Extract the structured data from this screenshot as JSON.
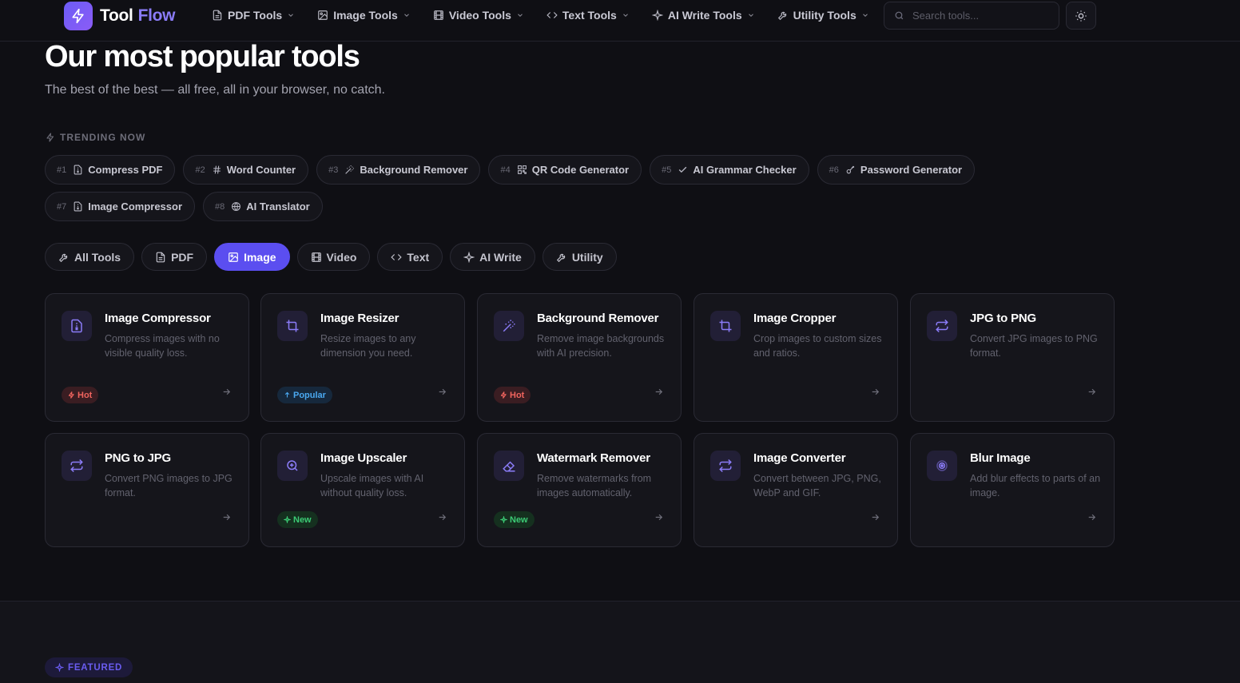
{
  "brand": {
    "name_a": "Tool",
    "name_b": "Flow",
    "accent": "#8b7cf8"
  },
  "nav": {
    "items": [
      {
        "label": "PDF Tools",
        "icon": "file-icon"
      },
      {
        "label": "Image Tools",
        "icon": "image-icon"
      },
      {
        "label": "Video Tools",
        "icon": "film-icon"
      },
      {
        "label": "Text Tools",
        "icon": "code-icon"
      },
      {
        "label": "AI Write Tools",
        "icon": "sparkle-icon"
      },
      {
        "label": "Utility Tools",
        "icon": "wrench-icon"
      }
    ]
  },
  "search": {
    "placeholder": "Search tools..."
  },
  "hero": {
    "title": "Our most popular tools",
    "subtitle": "The best of the best — all free, all in your browser, no catch."
  },
  "trending": {
    "label": "TRENDING NOW",
    "items": [
      {
        "rank": "#1",
        "label": "Compress PDF",
        "icon": "file-zip-icon"
      },
      {
        "rank": "#2",
        "label": "Word Counter",
        "icon": "hash-icon"
      },
      {
        "rank": "#3",
        "label": "Background Remover",
        "icon": "wand-icon"
      },
      {
        "rank": "#4",
        "label": "QR Code Generator",
        "icon": "qr-icon"
      },
      {
        "rank": "#5",
        "label": "AI Grammar Checker",
        "icon": "check-icon"
      },
      {
        "rank": "#6",
        "label": "Password Generator",
        "icon": "key-icon"
      },
      {
        "rank": "#7",
        "label": "Image Compressor",
        "icon": "file-zip-icon"
      },
      {
        "rank": "#8",
        "label": "AI Translator",
        "icon": "globe-icon"
      }
    ]
  },
  "tabs": [
    {
      "label": "All Tools",
      "icon": "wrench-icon",
      "active": false
    },
    {
      "label": "PDF",
      "icon": "file-icon",
      "active": false
    },
    {
      "label": "Image",
      "icon": "image-icon",
      "active": true
    },
    {
      "label": "Video",
      "icon": "film-icon",
      "active": false
    },
    {
      "label": "Text",
      "icon": "code-icon",
      "active": false
    },
    {
      "label": "AI Write",
      "icon": "sparkle-icon",
      "active": false
    },
    {
      "label": "Utility",
      "icon": "wrench-icon",
      "active": false
    }
  ],
  "cards": [
    {
      "title": "Image Compressor",
      "desc": "Compress images with no visible quality loss.",
      "badge": "Hot",
      "icon": "file-zip-icon"
    },
    {
      "title": "Image Resizer",
      "desc": "Resize images to any dimension you need.",
      "badge": "Popular",
      "icon": "crop-icon"
    },
    {
      "title": "Background Remover",
      "desc": "Remove image backgrounds with AI precision.",
      "badge": "Hot",
      "icon": "wand-icon"
    },
    {
      "title": "Image Cropper",
      "desc": "Crop images to custom sizes and ratios.",
      "badge": "",
      "icon": "crop-icon"
    },
    {
      "title": "JPG to PNG",
      "desc": "Convert JPG images to PNG format.",
      "badge": "",
      "icon": "convert-icon"
    },
    {
      "title": "PNG to JPG",
      "desc": "Convert PNG images to JPG format.",
      "badge": "",
      "icon": "convert-icon"
    },
    {
      "title": "Image Upscaler",
      "desc": "Upscale images with AI without quality loss.",
      "badge": "New",
      "icon": "zoom-in-icon"
    },
    {
      "title": "Watermark Remover",
      "desc": "Remove watermarks from images automatically.",
      "badge": "New",
      "icon": "eraser-icon"
    },
    {
      "title": "Image Converter",
      "desc": "Convert between JPG, PNG, WebP and GIF.",
      "badge": "",
      "icon": "convert-icon"
    },
    {
      "title": "Blur Image",
      "desc": "Add blur effects to parts of an image.",
      "badge": "",
      "icon": "target-icon"
    }
  ],
  "featured": {
    "label": "FEATURED"
  },
  "colors": {
    "background": "#0f0f14",
    "card": "#15151b",
    "primary": "#5b4ef0",
    "hot": "#f0645e",
    "popular": "#4aa8f0",
    "new": "#3ccb75"
  }
}
